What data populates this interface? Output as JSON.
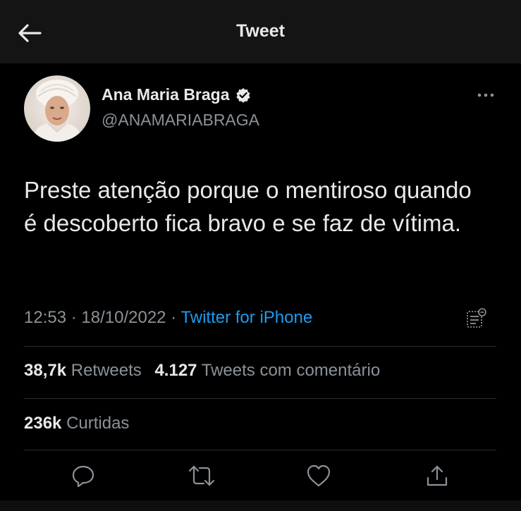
{
  "header": {
    "title": "Tweet",
    "back_icon": "arrow-left-icon"
  },
  "author": {
    "display_name": "Ana Maria Braga",
    "handle": "@ANAMARIABRAGA",
    "verified_icon": "verified-badge-icon"
  },
  "tweet": {
    "text": "Preste atenção porque o mentiroso quando é descoberto fica bravo e se faz de vítima.",
    "time": "12:53",
    "separator": " · ",
    "date": "18/10/2022",
    "source": "Twitter for iPhone"
  },
  "stats": {
    "retweets_count": "38,7k",
    "retweets_label": "Retweets",
    "quotes_count": "4.127",
    "quotes_label": "Tweets com comentário",
    "likes_count": "236k",
    "likes_label": "Curtidas"
  },
  "actions": [
    {
      "name": "reply",
      "icon": "reply-icon"
    },
    {
      "name": "retweet",
      "icon": "retweet-icon"
    },
    {
      "name": "like",
      "icon": "heart-icon"
    },
    {
      "name": "share",
      "icon": "share-icon"
    }
  ],
  "colors": {
    "background": "#000000",
    "text_primary": "#e7e9ea",
    "text_secondary": "#8b9298",
    "accent": "#1d9bf0",
    "verified": "#e7e9ea"
  }
}
